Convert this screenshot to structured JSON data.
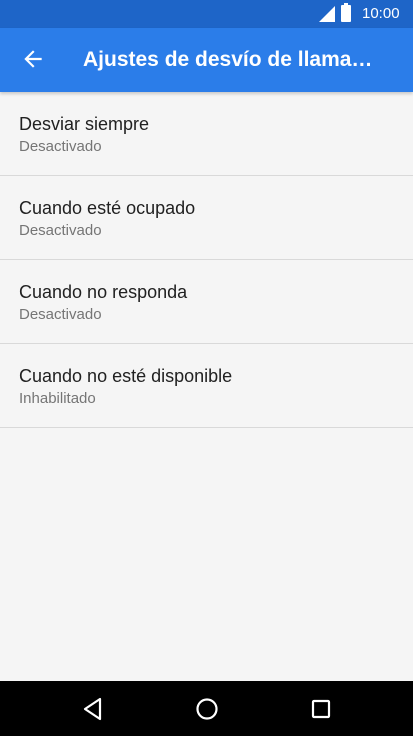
{
  "status_bar": {
    "time": "10:00",
    "icons": [
      "signal-icon",
      "battery-icon"
    ]
  },
  "app_bar": {
    "title": "Ajustes de desvío de llama…",
    "back_icon": "arrow-back-icon"
  },
  "forwarding_options": [
    {
      "label": "Desviar siempre",
      "status": "Desactivado"
    },
    {
      "label": "Cuando esté ocupado",
      "status": "Desactivado"
    },
    {
      "label": "Cuando no responda",
      "status": "Desactivado"
    },
    {
      "label": "Cuando no esté disponible",
      "status": "Inhabilitado"
    }
  ],
  "nav_bar": {
    "buttons": [
      "nav-back-icon",
      "nav-home-icon",
      "nav-recents-icon"
    ]
  },
  "colors": {
    "status_bar": "#1e65c8",
    "app_bar": "#2b7de9",
    "background": "#f5f5f5",
    "divider": "#d9d9d9",
    "primary_text": "#212121",
    "secondary_text": "#757575"
  }
}
